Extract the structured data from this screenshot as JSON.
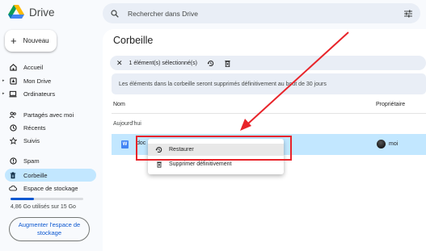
{
  "app": {
    "name": "Drive"
  },
  "search": {
    "placeholder": "Rechercher dans Drive"
  },
  "sidebar": {
    "new_label": "Nouveau",
    "items": [
      {
        "label": "Accueil",
        "icon": "home-icon"
      },
      {
        "label": "Mon Drive",
        "icon": "my-drive-icon"
      },
      {
        "label": "Ordinateurs",
        "icon": "computer-icon"
      },
      {
        "label": "Partagés avec moi",
        "icon": "people-icon"
      },
      {
        "label": "Récents",
        "icon": "clock-icon"
      },
      {
        "label": "Suivis",
        "icon": "star-icon"
      },
      {
        "label": "Spam",
        "icon": "spam-icon"
      },
      {
        "label": "Corbeille",
        "icon": "trash-icon",
        "active": true
      },
      {
        "label": "Espace de stockage",
        "icon": "cloud-icon"
      }
    ],
    "storage_used_fraction": 0.32,
    "storage_text": "4,86 Go utilisés sur 15 Go",
    "upgrade_label": "Augmenter l'espace de stockage"
  },
  "main": {
    "title": "Corbeille",
    "selection_text": "1 élément(s) sélectionné(s)",
    "info_banner": "Les éléments dans la corbeille seront supprimés définitivement au bout de 30 jours",
    "columns": {
      "name": "Nom",
      "owner": "Propriétaire"
    },
    "group_label": "Aujourd'hui",
    "file": {
      "name": "doc",
      "owner": "moi",
      "type_letter": "W"
    }
  },
  "context_menu": {
    "items": [
      {
        "label": "Restaurer",
        "icon": "restore-icon"
      },
      {
        "label": "Supprimer définitivement",
        "icon": "delete-forever-icon"
      }
    ]
  },
  "colors": {
    "accent": "#0b57d0",
    "selected_row": "#c2e7ff",
    "annotation": "#e8242a"
  }
}
